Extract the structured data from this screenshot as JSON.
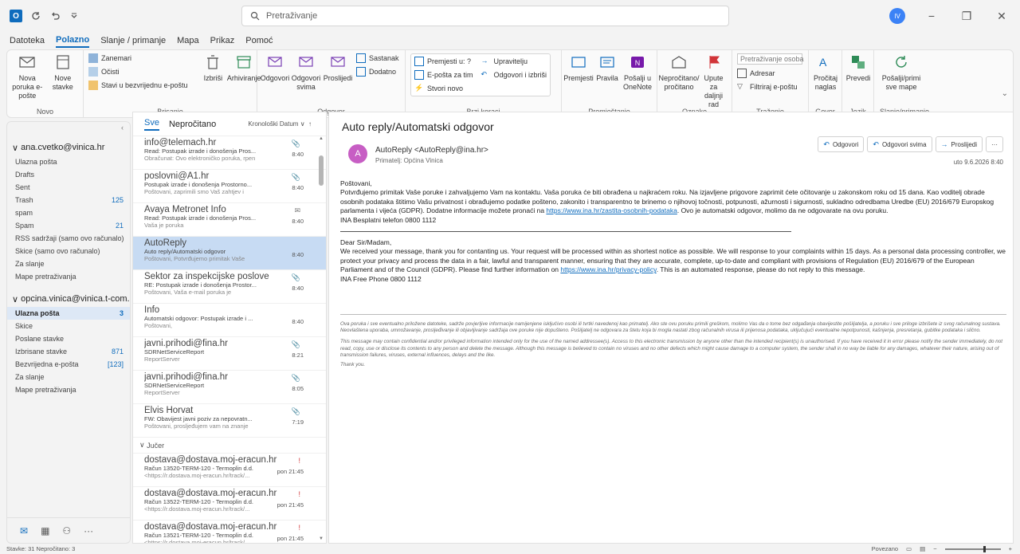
{
  "search": {
    "placeholder": "Pretraživanje"
  },
  "window": {
    "user_initials": "IV"
  },
  "menu_tabs": [
    "Datoteka",
    "Polazno",
    "Slanje / primanje",
    "Mapa",
    "Prikaz",
    "Pomoć"
  ],
  "ribbon": {
    "novo": {
      "new_email": "Nova poruka e-pošte",
      "new_items": "Nove stavke",
      "group": "Novo"
    },
    "brisanje": {
      "ignore": "Zanemari",
      "clean": "Očisti",
      "junk": "Stavi u bezvrijednu e-poštu",
      "delete": "Izbriši",
      "archive": "Arhiviranje",
      "group": "Brisanje"
    },
    "odgovor": {
      "reply": "Odgovori",
      "reply_all": "Odgovori svima",
      "forward": "Proslijedi",
      "meeting": "Sastanak",
      "more": "Dodatno",
      "group": "Odgovor"
    },
    "brzi_koraci": {
      "s1": "Premjesti u: ?",
      "s2": "E-pošta za tim",
      "s3": "Stvori novo",
      "s4": "Upravitelju",
      "s5": "Odgovori i izbriši",
      "group": "Brzi koraci"
    },
    "premjestanje": {
      "move": "Premjesti",
      "rules": "Pravila",
      "onenote": "Pošalji u OneNote",
      "group": "Premještanje"
    },
    "oznake": {
      "unread": "Nepročitano/ pročitano",
      "followup": "Upute za daljnji rad",
      "group": "Oznake"
    },
    "trazenje": {
      "people": "Pretraživanje osoba",
      "address": "Adresar",
      "filter": "Filtriraj e-poštu",
      "group": "Traženje"
    },
    "govor": {
      "read_aloud": "Pročitaj naglas",
      "group": "Govor"
    },
    "jezik": {
      "translate": "Prevedi",
      "group": "Jezik"
    },
    "slanje": {
      "sendrecv": "Pošalji/primi sve mape",
      "group": "Slanje/primanje"
    }
  },
  "folders": {
    "account1": "ana.cvetko@vinica.hr",
    "acc1_items": [
      {
        "name": "Ulazna pošta",
        "count": ""
      },
      {
        "name": "Drafts",
        "count": ""
      },
      {
        "name": "Sent",
        "count": ""
      },
      {
        "name": "Trash",
        "count": "125"
      },
      {
        "name": "spam",
        "count": ""
      },
      {
        "name": "Spam",
        "count": "21"
      },
      {
        "name": "RSS sadržaji (samo ovo računalo)",
        "count": ""
      },
      {
        "name": "Skice (samo ovo računalo)",
        "count": ""
      },
      {
        "name": "Za slanje",
        "count": ""
      },
      {
        "name": "Mape pretraživanja",
        "count": ""
      }
    ],
    "account2": "opcina.vinica@vinica.t-com.hr",
    "acc2_items": [
      {
        "name": "Ulazna pošta",
        "count": "3"
      },
      {
        "name": "Skice",
        "count": ""
      },
      {
        "name": "Poslane stavke",
        "count": ""
      },
      {
        "name": "Izbrisane stavke",
        "count": "871"
      },
      {
        "name": "Bezvrijedna e-pošta",
        "count": "[123]"
      },
      {
        "name": "Za slanje",
        "count": ""
      },
      {
        "name": "Mape pretraživanja",
        "count": ""
      }
    ]
  },
  "list": {
    "filter_all": "Sve",
    "filter_unread": "Nepročitano",
    "sort": "Kronološki Datum ∨",
    "mails": [
      {
        "from": "info@telemach.hr",
        "subject": "Read: Postupak izrade i donošenja Pros...",
        "preview": "Obračunat: Ovo elektroničko poruka, rpen",
        "time": "8:40",
        "flag": "📎",
        "red": false
      },
      {
        "from": "poslovni@A1.hr",
        "subject": "Postupak izrade i donošenja Prostorno...",
        "preview": "Poštovani, zaprimili smo Vaš zahtjev i",
        "time": "8:40",
        "flag": "📎",
        "red": false
      },
      {
        "from": "Avaya Metronet Info",
        "subject": "Read: Postupak izrade i donošenja Pros...",
        "preview": "Vaša je poruka",
        "time": "8:40",
        "flag": "✉",
        "red": false
      },
      {
        "from": "AutoReply",
        "subject": "Auto reply/Automatski odgovor",
        "preview": "Poštovani, Potvrđujemo primitak Vaše",
        "time": "8:40",
        "flag": "",
        "red": false
      },
      {
        "from": "Sektor za inspekcijske poslove",
        "subject": "RE: Postupak izrade i donošenja Prostor...",
        "preview": "Poštovani, Vaša e-mail poruka je",
        "time": "8:40",
        "flag": "📎",
        "red": false
      },
      {
        "from": "Info",
        "subject": "Automatski odgovor: Postupak izrade i ...",
        "preview": "Poštovani,",
        "time": "8:40",
        "flag": "",
        "red": false
      },
      {
        "from": "javni.prihodi@fina.hr",
        "subject": "SDRNetServiceReport",
        "preview": "ReportServer",
        "time": "8:21",
        "flag": "📎",
        "red": false
      },
      {
        "from": "javni.prihodi@fina.hr",
        "subject": "SDRNetServiceReport",
        "preview": "ReportServer",
        "time": "8:05",
        "flag": "📎",
        "red": false
      },
      {
        "from": "Elvis Horvat",
        "subject": "FW: Obavijest javni poziv za nepovratn...",
        "preview": "Poštovani, prosljeđujem vam na znanje",
        "time": "7:19",
        "flag": "📎",
        "red": false
      }
    ],
    "group_yesterday": "Jučer",
    "mails2": [
      {
        "from": "dostava@dostava.moj-eracun.hr",
        "subject": "Račun 13520-TERM-120 - Termoplin d.d.",
        "preview": "<https://r.dostava.moj-eracun.hr/track/...",
        "time": "pon 21:45",
        "flag": "!",
        "red": true
      },
      {
        "from": "dostava@dostava.moj-eracun.hr",
        "subject": "Račun 13522-TERM-120 - Termoplin d.d.",
        "preview": "<https://r.dostava.moj-eracun.hr/track/...",
        "time": "pon 21:45",
        "flag": "!",
        "red": true
      },
      {
        "from": "dostava@dostava.moj-eracun.hr",
        "subject": "Račun 13521-TERM-120 - Termoplin d.d.",
        "preview": "<https://r.dostava.moj-eracun.hr/track/...",
        "time": "pon 21:45",
        "flag": "!",
        "red": true
      }
    ]
  },
  "reading": {
    "subject": "Auto reply/Automatski odgovor",
    "avatar_letter": "A",
    "sender": "AutoReply <AutoReply@ina.hr>",
    "to": "Primatelj: Općina Vinica",
    "reply": "Odgovori",
    "reply_all": "Odgovori svima",
    "forward": "Proslijedi",
    "more": "···",
    "date": "uto 9.6.2026 8:40",
    "hr_greeting": "Poštovani,",
    "hr_p1a": "Potvrđujemo primitak Vaše poruke i zahvaljujemo Vam na kontaktu. Vaša poruka će biti obrađena u najkraćem roku. Na izjavljene prigovore zaprimit ćete očitovanje u zakonskom roku od 15 dana. Kao voditelj obrade osobnih podataka štitimo Vašu privatnost i obrađujemo podatke pošteno, zakonito i transparentno te brinemo o njihovoj točnosti, potpunosti, ažurnosti i sigurnosti, sukladno odredbama Uredbe (EU) 2016/679 Europskog parlamenta i vijeća (GDPR). Dodatne informacije možete pronaći na ",
    "hr_link": "https://www.ina.hr/zastita-osobnih-podataka",
    "hr_p1b": ". Ovo je automatski odgovor, molimo da ne odgovarate na ovu poruku.",
    "hr_phone": "INA Besplatni telefon 0800 1112",
    "en_greeting": "Dear Sir/Madam,",
    "en_p1a": "We received your message, thank you for contanting us. Your request will be processed within as shortest notice as possible. We will response to your complaints within 15 days. As a personal data processing controller, we protect your privacy and process the data in a fair, lawful and transparent manner, ensuring that they are accurate, complete, up-to-date and compliant with provisions of Regulation (EU) 2016/679 of the European Parliament and of the Council (GDPR). Please find further information on ",
    "en_link": "https://www.ina.hr/privacy-policy",
    "en_p1b": ". This is an automated response, please do not reply to this message.",
    "en_phone": "INA Free Phone 0800 1112",
    "disc_hr": "Ova poruka i sve eventualno priložene datoteke, sadrže povjerljive informacije namijenjene isključivo osobi ili tvrtki navedenoj kao primatelj. Ako ste ovu poruku primili greškom, molimo Vas da o tome bez odgađanja obavijestite pošiljatelja, a poruku i sve priloge izbrišete iz svog računalnog sustava. Neovlaštena uporaba, umnožavanje, prosljeđivanje ili objavljivanje sadržaja ove poruke nije dopušteno. Pošiljatelj ne odgovara za štetu koja bi mogla nastati zbog računalnih virusa ili prijenosa podataka, uključujući eventualne nepotpunosti, kašnjenja, presretanja, gubitke podataka i slično.",
    "disc_en": "This message may contain confidential and/or privileged information intended only for the use of the named addressee(s). Access to this electronic transmission by anyone other than the intended recipient(s) is unauthorised. If you have received it in error please notify the sender immediately, do not read, copy, use or disclose its contents to any person and delete the message. Although this message is believed to contain no viruses and no other defects which might cause damage to a computer system, the sender shall in no way be liable for any damages, whatever their nature, arising out of transmission failures, viruses, external influences, delays and the like.",
    "disc_thanks": "Thank you."
  },
  "status": {
    "left": "Stavke: 31   Nepročitano: 3",
    "right": "Povezano"
  }
}
